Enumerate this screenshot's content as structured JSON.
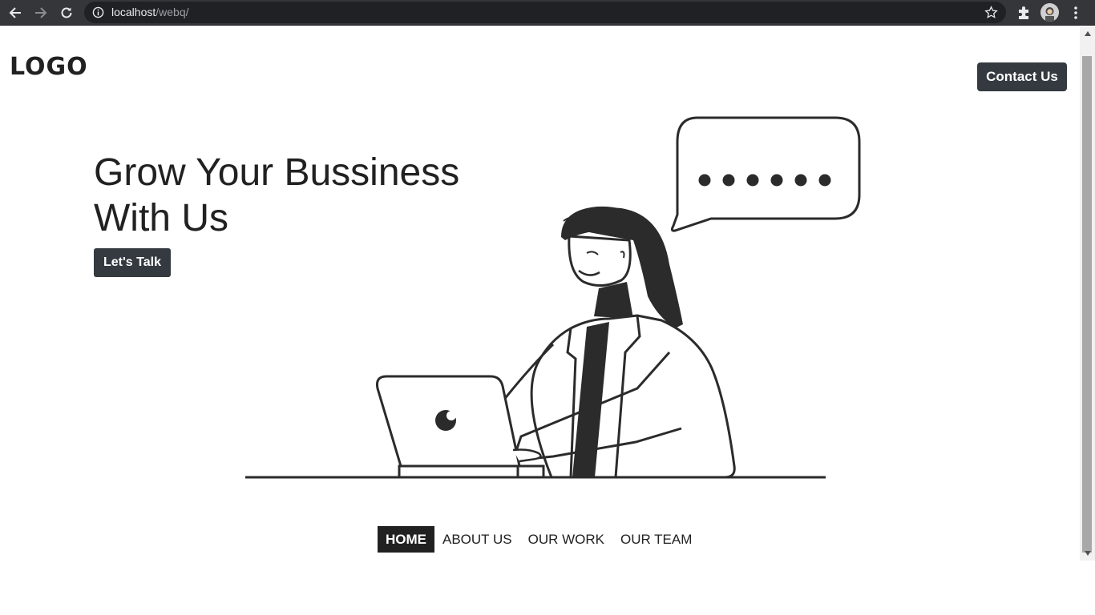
{
  "browser": {
    "url_host": "localhost",
    "url_path": "/webq/",
    "icons": {
      "back": "arrow-left-icon",
      "forward": "arrow-right-icon",
      "reload": "reload-icon",
      "info": "info-icon",
      "bookmark": "star-icon",
      "extensions": "puzzle-icon",
      "menu": "kebab-menu-icon"
    }
  },
  "header": {
    "logo": "LOGO",
    "contact_label": "Contact Us"
  },
  "hero": {
    "title": "Grow Your Bussiness With Us",
    "cta_label": "Let's Talk"
  },
  "nav": {
    "items": [
      {
        "label": "HOME",
        "active": true
      },
      {
        "label": "ABOUT US",
        "active": false
      },
      {
        "label": "OUR WORK",
        "active": false
      },
      {
        "label": "OUR TEAM",
        "active": false
      }
    ]
  },
  "colors": {
    "button_bg": "#343a40",
    "text": "#212121",
    "chrome_bg": "#35363a",
    "active_nav_bg": "#212121"
  }
}
